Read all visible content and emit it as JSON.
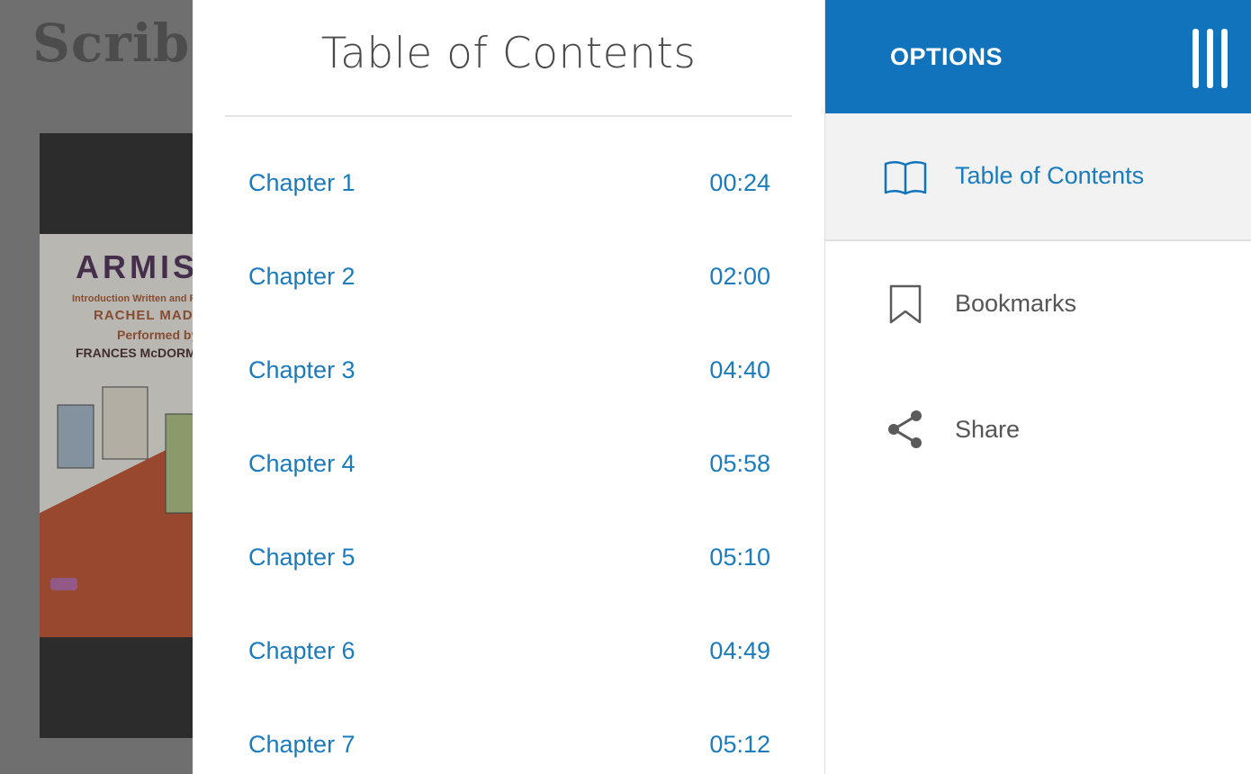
{
  "background": {
    "logo": "Scribd",
    "cover": {
      "title": "ARMISTEAD",
      "intro_line": "Introduction Written and Read by",
      "intro_author": "RACHEL MADDOW",
      "performed_line": "Performed by",
      "narrator": "FRANCES McDORMAND"
    }
  },
  "toc": {
    "title": "Table of Contents",
    "chapters": [
      {
        "name": "Chapter 1",
        "time": "00:24"
      },
      {
        "name": "Chapter 2",
        "time": "02:00"
      },
      {
        "name": "Chapter 3",
        "time": "04:40"
      },
      {
        "name": "Chapter 4",
        "time": "05:58"
      },
      {
        "name": "Chapter 5",
        "time": "05:10"
      },
      {
        "name": "Chapter 6",
        "time": "04:49"
      },
      {
        "name": "Chapter 7",
        "time": "05:12"
      }
    ]
  },
  "options": {
    "title": "OPTIONS",
    "items": [
      {
        "label": "Table of Contents",
        "icon": "book-icon",
        "active": true
      },
      {
        "label": "Bookmarks",
        "icon": "bookmark-icon",
        "active": false
      },
      {
        "label": "Share",
        "icon": "share-icon",
        "active": false
      }
    ]
  },
  "colors": {
    "accent": "#1173bb",
    "link": "#1a7bbd",
    "text_gray": "#555555"
  }
}
